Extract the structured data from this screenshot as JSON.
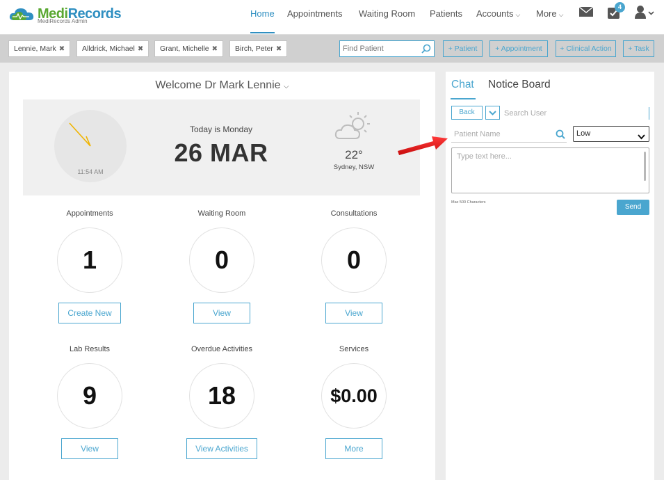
{
  "brand": {
    "name_part1": "Medi",
    "name_part2": "Records",
    "subtitle": "MediRecords Admin"
  },
  "nav": {
    "items": [
      {
        "label": "Home",
        "active": true
      },
      {
        "label": "Appointments"
      },
      {
        "label": "Waiting Room"
      },
      {
        "label": "Patients"
      },
      {
        "label": "Accounts"
      },
      {
        "label": "More"
      }
    ],
    "tasks_badge": "4",
    "icons": [
      "mail-icon",
      "tasks-icon",
      "user-icon"
    ]
  },
  "patient_bar": {
    "tabs": [
      "Lennie, Mark",
      "Alldrick, Michael",
      "Grant, Michelle",
      "Birch, Peter"
    ],
    "find_placeholder": "Find Patient",
    "actions": [
      "+ Patient",
      "+ Appointment",
      "+ Clinical Action",
      "+ Task"
    ]
  },
  "dashboard": {
    "welcome": "Welcome Dr Mark Lennie",
    "clock_time": "11:54 AM",
    "today_label": "Today is Monday",
    "date": "26 MAR",
    "temperature": "22°",
    "location": "Sydney, NSW",
    "weather_icon": "partly-cloudy-icon",
    "stats": [
      {
        "label": "Appointments",
        "value": "1",
        "button": "Create New"
      },
      {
        "label": "Waiting Room",
        "value": "0",
        "button": "View"
      },
      {
        "label": "Consultations",
        "value": "0",
        "button": "View"
      },
      {
        "label": "Lab Results",
        "value": "9",
        "button": "View"
      },
      {
        "label": "Overdue Activities",
        "value": "18",
        "button": "View Activities"
      },
      {
        "label": "Services",
        "value": "$0.00",
        "button": "More"
      }
    ]
  },
  "chat": {
    "tabs": [
      "Chat",
      "Notice Board"
    ],
    "back_label": "Back",
    "search_user_placeholder": "Search User",
    "patient_name_placeholder": "Patient Name",
    "priority": "Low",
    "message_placeholder": "Type text here...",
    "max_chars": "Max 500 Characters",
    "send_label": "Send"
  },
  "colors": {
    "accent": "#4aa6cf",
    "brand_green": "#5aa832",
    "brand_blue": "#2f8fc1",
    "annotation_arrow": "#e3161b"
  }
}
